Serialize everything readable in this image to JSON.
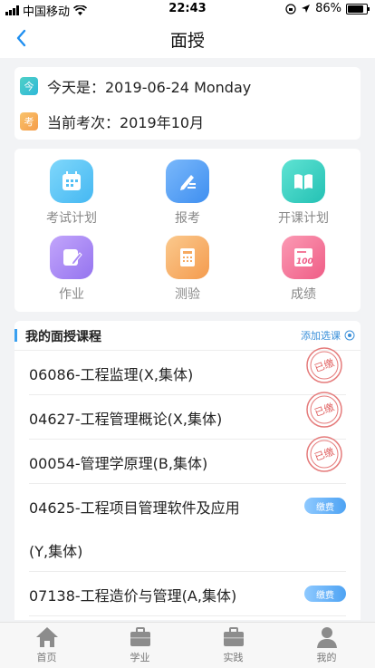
{
  "status": {
    "carrier": "中国移动",
    "time": "22:43",
    "battery": "86%"
  },
  "nav": {
    "title": "面授"
  },
  "info": {
    "today_badge": "今",
    "today_text": "今天是：2019-06-24 Monday",
    "exam_badge": "考",
    "exam_text": "当前考次：2019年10月"
  },
  "menu": {
    "items": [
      {
        "label": "考试计划",
        "icon": "calendar-icon",
        "color": "#62c8f6"
      },
      {
        "label": "报考",
        "icon": "edit-icon",
        "color": "#5aa6f6"
      },
      {
        "label": "开课计划",
        "icon": "book-icon",
        "color": "#3fd3c4"
      },
      {
        "label": "作业",
        "icon": "pencil-note-icon",
        "color": "#a88af5"
      },
      {
        "label": "测验",
        "icon": "calculator-icon",
        "color": "#f7b26b"
      },
      {
        "label": "成绩",
        "icon": "score-icon",
        "color": "#f47a9a"
      }
    ]
  },
  "courses": {
    "header": "我的面授课程",
    "add_label": "添加选课",
    "paid_stamp": "已缴",
    "pay_label": "缴费",
    "items": [
      {
        "name": "06086-工程监理(X,集体)",
        "status": "paid"
      },
      {
        "name": "04627-工程管理概论(X,集体)",
        "status": "paid"
      },
      {
        "name": "00054-管理学原理(B,集体)",
        "status": "paid"
      },
      {
        "name": "04625-工程项目管理软件及应用",
        "name2": "(Y,集体)",
        "status": "unpaid"
      },
      {
        "name": "07138-工程造价与管理(A,集体)",
        "status": "unpaid"
      }
    ]
  },
  "tabbar": {
    "items": [
      "首页",
      "学业",
      "实践",
      "我的"
    ]
  }
}
